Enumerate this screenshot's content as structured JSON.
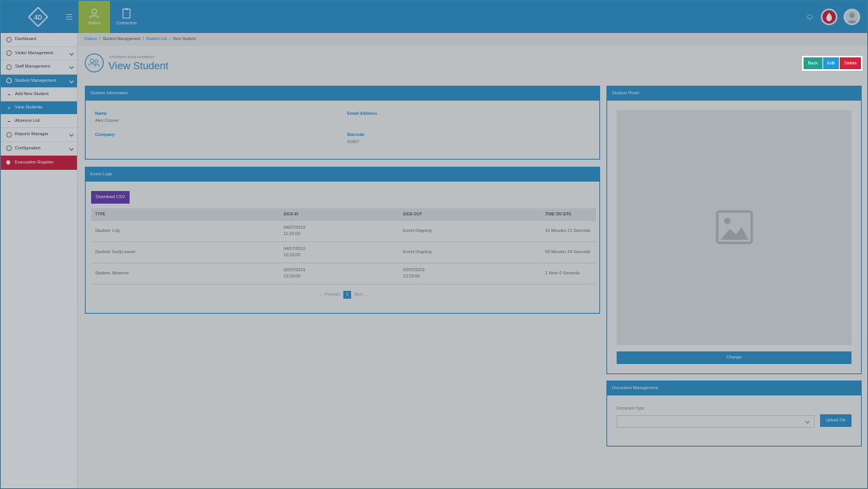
{
  "app": {
    "logo_text": "4D"
  },
  "top_tabs": [
    {
      "label": "Visitors",
      "icon": "user-icon",
      "active": true
    },
    {
      "label": "Contractors",
      "icon": "clipboard-icon",
      "active": false
    }
  ],
  "top_icons": {
    "bell": "bell-icon",
    "evacuation": "flame-icon",
    "user": "user-avatar-icon"
  },
  "sidebar": {
    "items": [
      {
        "label": "Dashboard",
        "icon": "dashboard-icon"
      },
      {
        "label": "Visitor Management",
        "icon": "user-icon"
      },
      {
        "label": "Staff Management",
        "icon": "staff-icon"
      },
      {
        "label": "Student Management",
        "icon": "student-icon"
      },
      {
        "label": "Add New Student"
      },
      {
        "label": "View Students"
      },
      {
        "label": "Absence List"
      },
      {
        "label": "Reports Manager",
        "icon": "reports-icon"
      },
      {
        "label": "Configuration",
        "icon": "gear-icon"
      },
      {
        "label": "Evacuation Register",
        "icon": "flame-icon"
      }
    ]
  },
  "breadcrumb": {
    "c1": "Visitors",
    "c2": "Student Management",
    "c3": "Student List",
    "c4": "View Student"
  },
  "page": {
    "subtitle": "STUDENT MANAGEMENT",
    "title": "View Student"
  },
  "actions": {
    "back": "Back",
    "edit": "Edit",
    "delete": "Delete"
  },
  "student_info": {
    "header": "Student Information",
    "name_label": "Name",
    "name_value": "Alex Conner",
    "email_label": "Email Address",
    "email_value": "",
    "company_label": "Company",
    "company_value": "",
    "barcode_label": "Barcode",
    "barcode_value": "51607"
  },
  "event_logs": {
    "header": "Event Logs",
    "download": "Download CSV",
    "columns": [
      "TYPE",
      "SIGN IN",
      "SIGN OUT",
      "TIME ON SITE"
    ],
    "rows": [
      {
        "type": "Student: Log",
        "in_date": "04/07/2019",
        "in_time": "11:15:03",
        "out_date": "Event Ongoing",
        "out_time": "",
        "time": "16 Minutes 21 Seconds"
      },
      {
        "type": "Student: EarlyLeaver",
        "in_date": "04/07/2019",
        "in_time": "10:32:00",
        "out_date": "Event Ongoing",
        "out_time": "",
        "time": "59 Minutes 24 Seconds"
      },
      {
        "type": "Student: Absence",
        "in_date": "02/07/2019",
        "in_time": "12:29:00",
        "out_date": "02/07/2019",
        "out_time": "13:29:00",
        "time": "1 Hour 0 Seconds"
      }
    ],
    "pager": {
      "prev": "← Previous",
      "current": "1",
      "next": "Next →"
    }
  },
  "photo": {
    "header": "Student Photo",
    "change": "Change"
  },
  "documents": {
    "header": "Document Management",
    "type_label": "Document Type",
    "upload": "Upload File"
  }
}
